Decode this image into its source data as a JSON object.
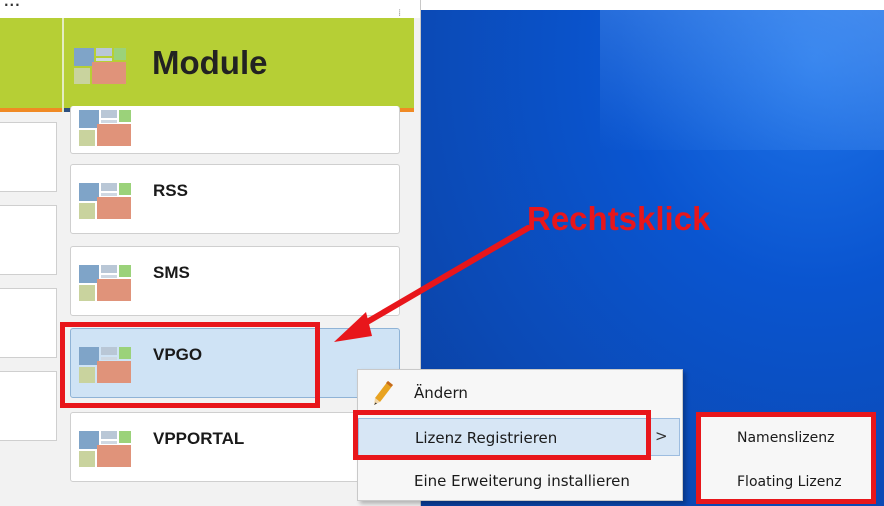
{
  "app": {
    "title_fragment": "..."
  },
  "header": {
    "title": "Module"
  },
  "modules": [
    {
      "label": ""
    },
    {
      "label": "RSS"
    },
    {
      "label": "SMS"
    },
    {
      "label": "VPGO"
    },
    {
      "label": "VPPORTAL"
    }
  ],
  "context_menu": {
    "items": [
      {
        "label": "Ändern",
        "icon": "pencil-icon"
      },
      {
        "label": "Lizenz Registrieren",
        "has_submenu": true
      },
      {
        "label": "Eine Erweiterung installieren"
      }
    ],
    "submenu_arrow": ">"
  },
  "submenu": {
    "items": [
      {
        "label": "Namenslizenz"
      },
      {
        "label": "Floating Lizenz"
      }
    ]
  },
  "annotation": {
    "text": "Rechtsklick",
    "color": "#e8161b"
  },
  "colors": {
    "header_green": "#b6cf35",
    "selection_blue": "#cfe3f5",
    "desktop_blue": "#0a55d0"
  }
}
